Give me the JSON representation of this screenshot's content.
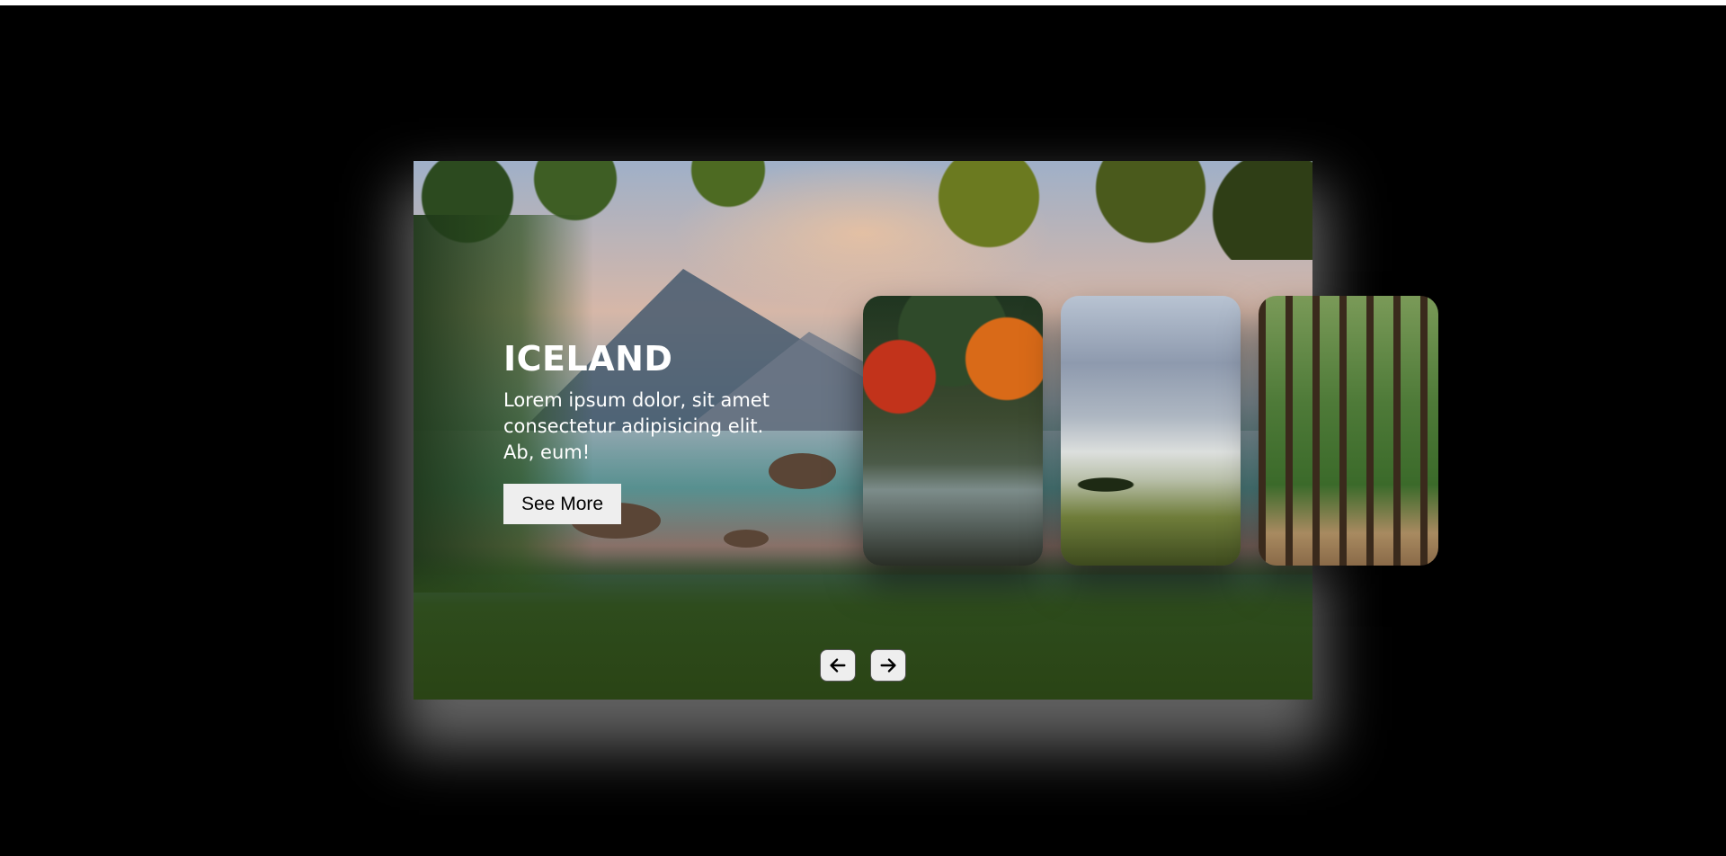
{
  "hero": {
    "title": "ICELAND",
    "description": "Lorem ipsum dolor, sit amet consectetur adipisicing elit. Ab, eum!",
    "button_label": "See More"
  },
  "thumbnails": [
    {
      "name": "autumn-forest-river"
    },
    {
      "name": "misty-meadow-mountains"
    },
    {
      "name": "forest-path"
    }
  ],
  "navigation": {
    "prev_icon": "arrow-left-icon",
    "next_icon": "arrow-right-icon"
  },
  "colors": {
    "page_background": "#000000",
    "button_background": "#eeeeee",
    "title_text": "#ffffff"
  }
}
